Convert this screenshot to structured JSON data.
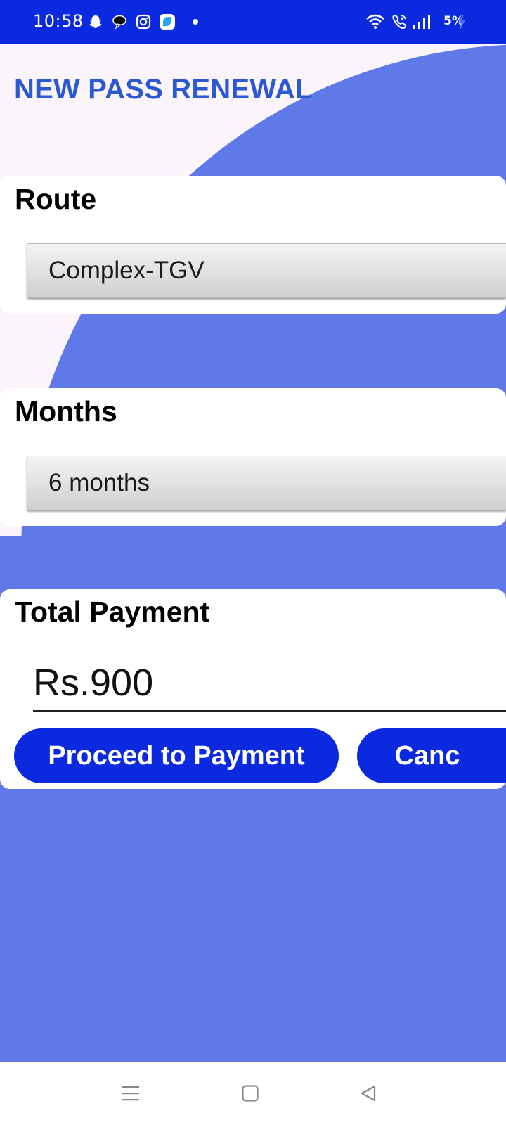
{
  "status_bar": {
    "time": "10:58",
    "battery": "5%",
    "left_icons": [
      "snapchat-icon",
      "chat-bubble-icon",
      "instagram-icon",
      "app-icon",
      "dot-icon"
    ],
    "right_icons": [
      "wifi-icon",
      "wifi-call-icon",
      "signal-icon",
      "charging-icon"
    ]
  },
  "page": {
    "title": "NEW PASS RENEWAL",
    "accent_color": "#0b2adf",
    "background_color": "#5f79e8",
    "title_color": "#2b58d3"
  },
  "route": {
    "label": "Route",
    "selected": "Complex-TGV"
  },
  "months": {
    "label": "Months",
    "selected": "6 months"
  },
  "payment": {
    "label": "Total Payment",
    "amount": "Rs.900",
    "proceed_label": "Proceed to Payment",
    "cancel_label": "Canc"
  },
  "nav_bar": {
    "icons": [
      "menu-icon",
      "home-icon",
      "back-icon"
    ]
  }
}
